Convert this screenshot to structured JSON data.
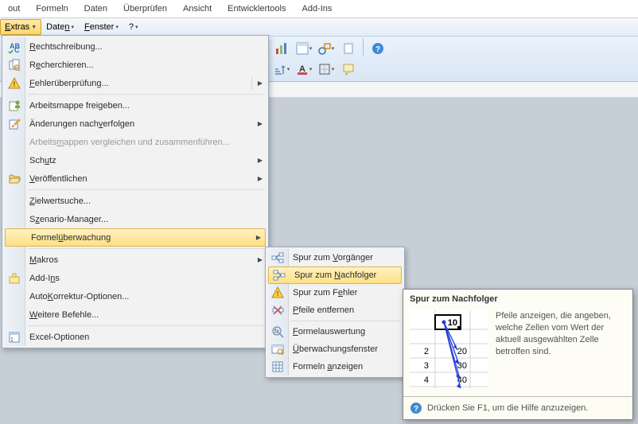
{
  "ribbon_tabs": {
    "t0": "out",
    "t1": "Formeln",
    "t2": "Daten",
    "t3": "Überprüfen",
    "t4": "Ansicht",
    "t5": "Entwicklertools",
    "t6": "Add-Ins"
  },
  "menubar": {
    "extras": "Extras",
    "daten": "Daten",
    "fenster": "Fenster",
    "q": "?"
  },
  "extras_menu": {
    "rechtschreibung": "Rechtschreibung...",
    "recherchieren": "Recherchieren...",
    "fehler": "Fehlerüberprüfung...",
    "freigeben": "Arbeitsmappe freigeben...",
    "nachverfolgen": "Änderungen nachverfolgen",
    "vergleichen": "Arbeitsmappen vergleichen und zusammenführen...",
    "schutz": "Schutz",
    "veroeffentlichen": "Veröffentlichen",
    "zielwert": "Zielwertsuche...",
    "szenario": "Szenario-Manager...",
    "formelueberw": "Formelüberwachung",
    "makros": "Makros",
    "addins": "Add-Ins",
    "autokorrekt": "AutoKorrektur-Optionen...",
    "weitere": "Weitere Befehle...",
    "exceloptionen": "Excel-Optionen"
  },
  "submenu": {
    "vorgaenger": "Spur zum Vorgänger",
    "nachfolger": "Spur zum Nachfolger",
    "fehler": "Spur zum Fehler",
    "entfernen": "Pfeile entfernen",
    "auswertung": "Formelauswertung",
    "ueberwachung": "Überwachungsfenster",
    "anzeigen": "Formeln anzeigen"
  },
  "tooltip": {
    "title": "Spur zum Nachfolger",
    "desc": "Pfeile anzeigen, die angeben, welche Zellen vom Wert der aktuell ausgewählten Zelle betroffen sind.",
    "footer": "Drücken Sie F1, um die Hilfe anzuzeigen."
  }
}
